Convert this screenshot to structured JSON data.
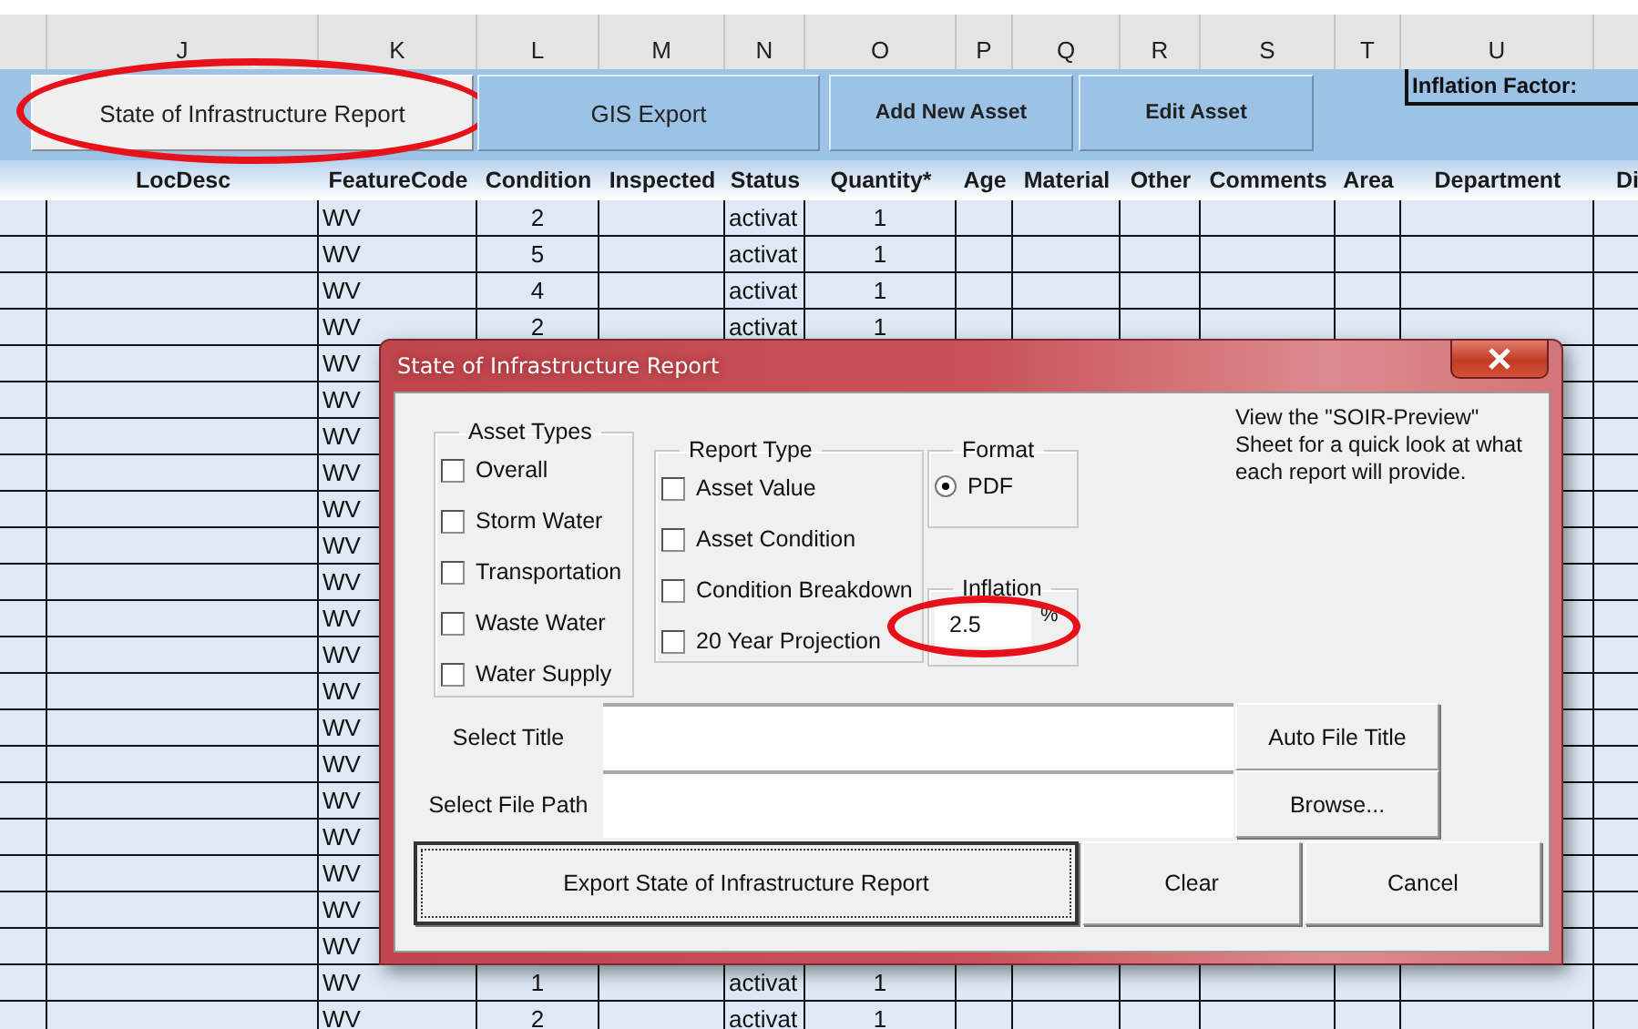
{
  "columns": [
    {
      "letter": "J",
      "header": "LocDesc"
    },
    {
      "letter": "K",
      "header": "FeatureCode"
    },
    {
      "letter": "L",
      "header": "Condition"
    },
    {
      "letter": "M",
      "header": "Inspected"
    },
    {
      "letter": "N",
      "header": "Status"
    },
    {
      "letter": "O",
      "header": "Quantity*"
    },
    {
      "letter": "P",
      "header": "Age"
    },
    {
      "letter": "Q",
      "header": "Material"
    },
    {
      "letter": "R",
      "header": "Other"
    },
    {
      "letter": "S",
      "header": "Comments"
    },
    {
      "letter": "T",
      "header": "Area"
    },
    {
      "letter": "U",
      "header": "Department"
    },
    {
      "header": "Di"
    }
  ],
  "toolbar": {
    "buttons": [
      {
        "label": "State of Infrastructure Report",
        "kind": "form",
        "bold": false,
        "highlighted": true
      },
      {
        "label": "GIS Export",
        "kind": "shape",
        "bold": false,
        "highlighted": false
      },
      {
        "label": "Add New Asset",
        "kind": "shape",
        "bold": true,
        "highlighted": false
      },
      {
        "label": "Edit Asset",
        "kind": "shape",
        "bold": true,
        "highlighted": false
      }
    ],
    "inflation_factor_label": "Inflation Factor:"
  },
  "rows": [
    {
      "cells": [
        null,
        "WV",
        "2",
        null,
        "activat",
        "1"
      ]
    },
    {
      "cells": [
        null,
        "WV",
        "5",
        null,
        "activat",
        "1"
      ]
    },
    {
      "cells": [
        null,
        "WV",
        "4",
        null,
        "activat",
        "1"
      ]
    },
    {
      "cells": [
        null,
        "WV",
        "2",
        null,
        "activat",
        "1"
      ]
    },
    {
      "cells": [
        null,
        "WV"
      ]
    },
    {
      "cells": [
        null,
        "WV"
      ]
    },
    {
      "cells": [
        null,
        "WV"
      ]
    },
    {
      "cells": [
        null,
        "WV"
      ]
    },
    {
      "cells": [
        null,
        "WV"
      ]
    },
    {
      "cells": [
        null,
        "WV"
      ]
    },
    {
      "cells": [
        null,
        "WV"
      ]
    },
    {
      "cells": [
        null,
        "WV"
      ]
    },
    {
      "cells": [
        null,
        "WV"
      ]
    },
    {
      "cells": [
        null,
        "WV"
      ]
    },
    {
      "cells": [
        null,
        "WV"
      ]
    },
    {
      "cells": [
        null,
        "WV"
      ]
    },
    {
      "cells": [
        null,
        "WV"
      ]
    },
    {
      "cells": [
        null,
        "WV"
      ]
    },
    {
      "cells": [
        null,
        "WV"
      ]
    },
    {
      "cells": [
        null,
        "WV"
      ]
    },
    {
      "cells": [
        null,
        "WV"
      ]
    },
    {
      "cells": [
        null,
        "WV",
        "1",
        null,
        "activat",
        "1"
      ]
    },
    {
      "cells": [
        null,
        "WV",
        "2",
        null,
        "activat",
        "1"
      ]
    }
  ],
  "dialog": {
    "title": "State of Infrastructure Report",
    "asset_types": {
      "label": "Asset Types",
      "items": [
        {
          "label": "Overall",
          "checked": false
        },
        {
          "label": "Storm Water",
          "checked": false
        },
        {
          "label": "Transportation",
          "checked": false
        },
        {
          "label": "Waste Water",
          "checked": false
        },
        {
          "label": "Water Supply",
          "checked": false
        }
      ]
    },
    "report_type": {
      "label": "Report Type",
      "items": [
        {
          "label": "Asset Value",
          "checked": false
        },
        {
          "label": "Asset Condition",
          "checked": false
        },
        {
          "label": "Condition Breakdown",
          "checked": false
        },
        {
          "label": "20 Year Projection",
          "checked": false
        }
      ]
    },
    "format": {
      "label": "Format",
      "options": [
        {
          "label": "PDF",
          "selected": true
        }
      ]
    },
    "inflation": {
      "label": "Inflation",
      "value": "2.5",
      "unit": "%",
      "highlighted": true
    },
    "note": "View the \"SOIR-Preview\" Sheet for a quick look at what each report will provide.",
    "fields": [
      {
        "label": "Select Title",
        "button": "Auto File Title"
      },
      {
        "label": "Select File Path",
        "button": "Browse..."
      }
    ],
    "buttons": [
      {
        "label": "Export State of Infrastructure Report",
        "focused": true
      },
      {
        "label": "Clear",
        "focused": false
      },
      {
        "label": "Cancel",
        "focused": false
      }
    ]
  }
}
